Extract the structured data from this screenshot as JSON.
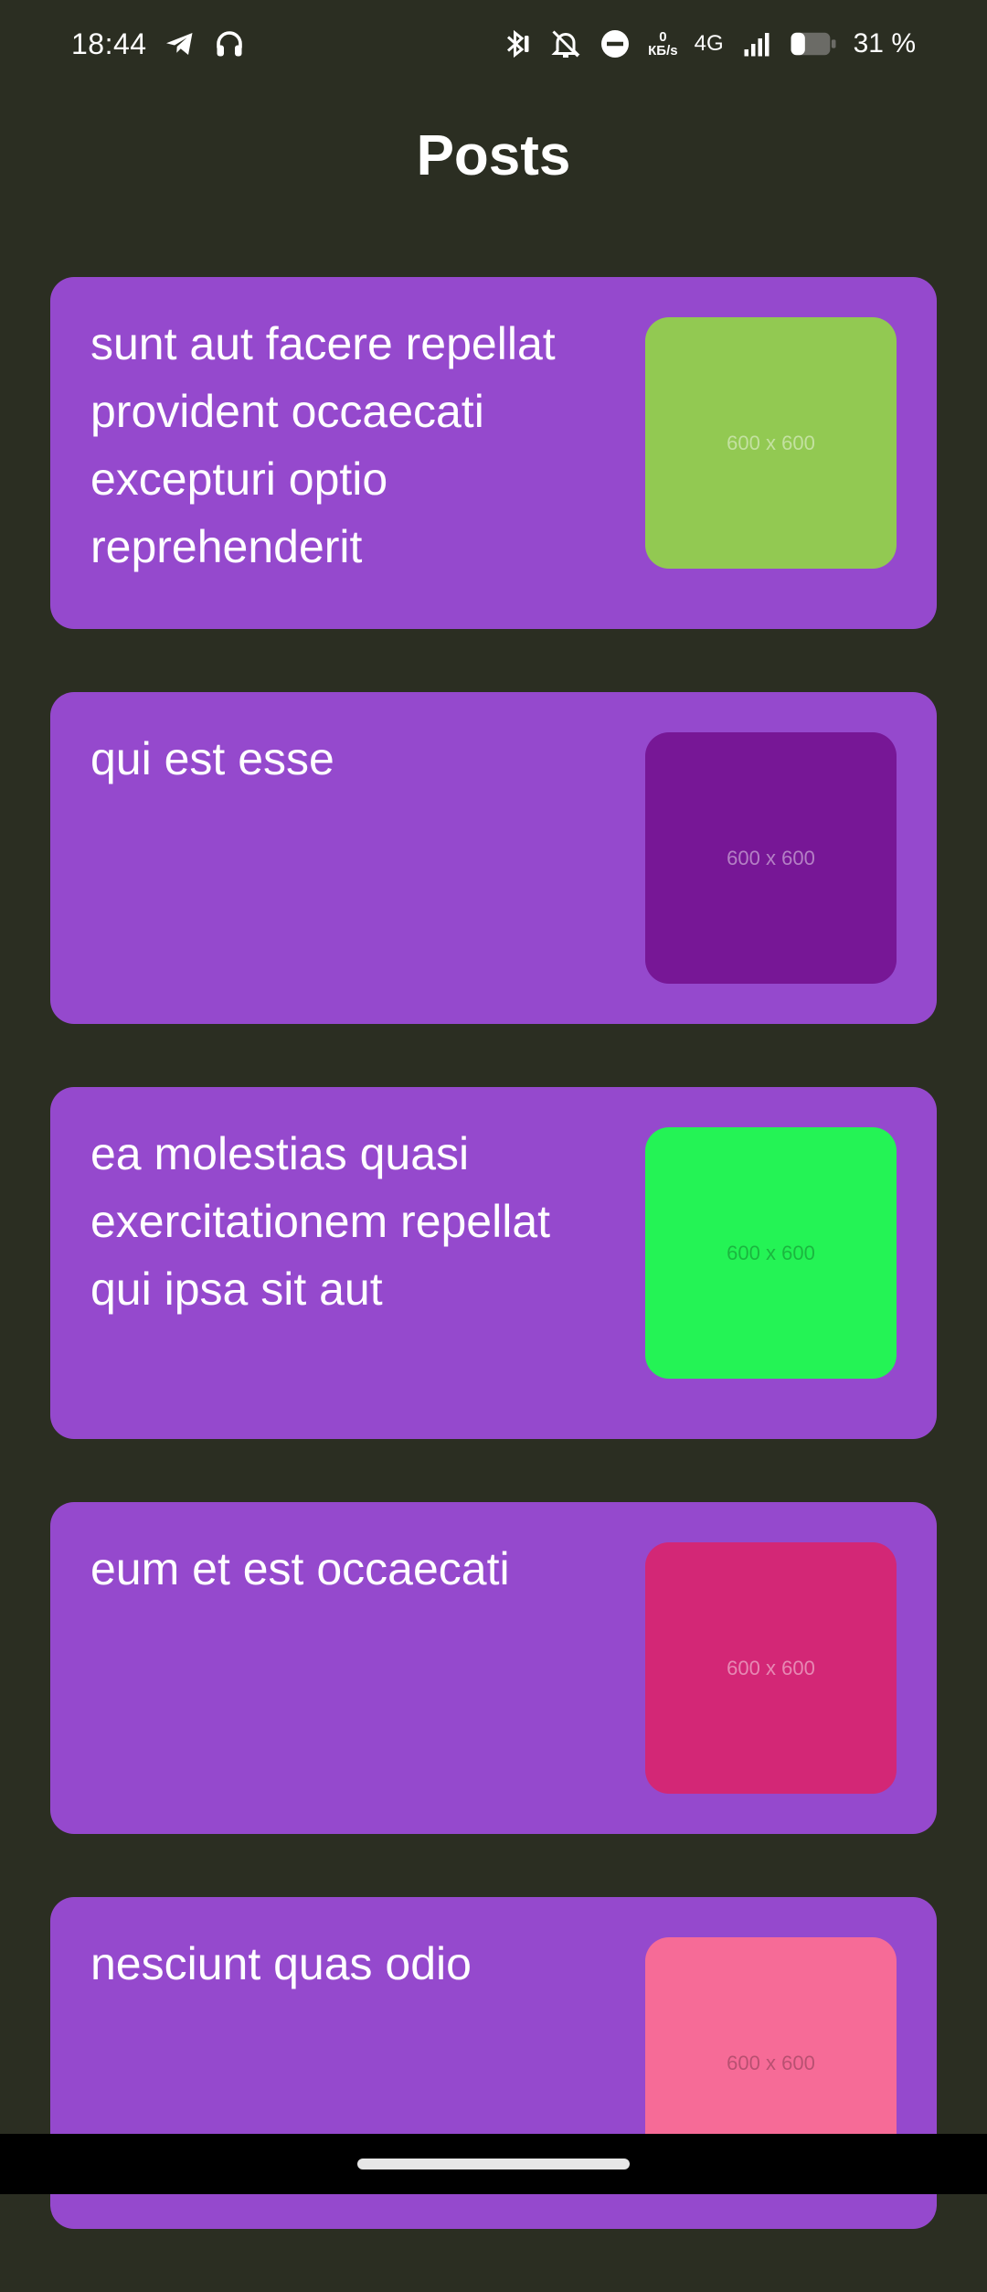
{
  "status_bar": {
    "time": "18:44",
    "left_icons": [
      "telegram-icon",
      "headphones-icon"
    ],
    "right_icons": [
      "bluetooth-icon",
      "bell-off-icon",
      "do-not-disturb-icon",
      "signal-icon",
      "battery-icon"
    ],
    "speed_value": "0",
    "speed_unit": "КБ/s",
    "network_type": "4G",
    "battery_percent": "31 %",
    "battery_level": 0.31
  },
  "header": {
    "title": "Posts"
  },
  "posts": [
    {
      "title": "sunt aut facere repellat provident occaecati excepturi optio reprehenderit",
      "thumb_label": "600 x 600",
      "thumb_color": "#92c952"
    },
    {
      "title": "qui est esse",
      "thumb_label": "600 x 600",
      "thumb_color": "#771796"
    },
    {
      "title": "ea molestias quasi exercitationem repellat qui ipsa sit aut",
      "thumb_label": "600 x 600",
      "thumb_color": "#24f355"
    },
    {
      "title": "eum et est occaecati",
      "thumb_label": "600 x 600",
      "thumb_color": "#d32776"
    },
    {
      "title": "nesciunt quas odio",
      "thumb_label": "600 x 600",
      "thumb_color": "#f66b97"
    }
  ],
  "colors": {
    "background": "#2b2e22",
    "card": "#9549cd",
    "nav_bar": "#000000"
  }
}
